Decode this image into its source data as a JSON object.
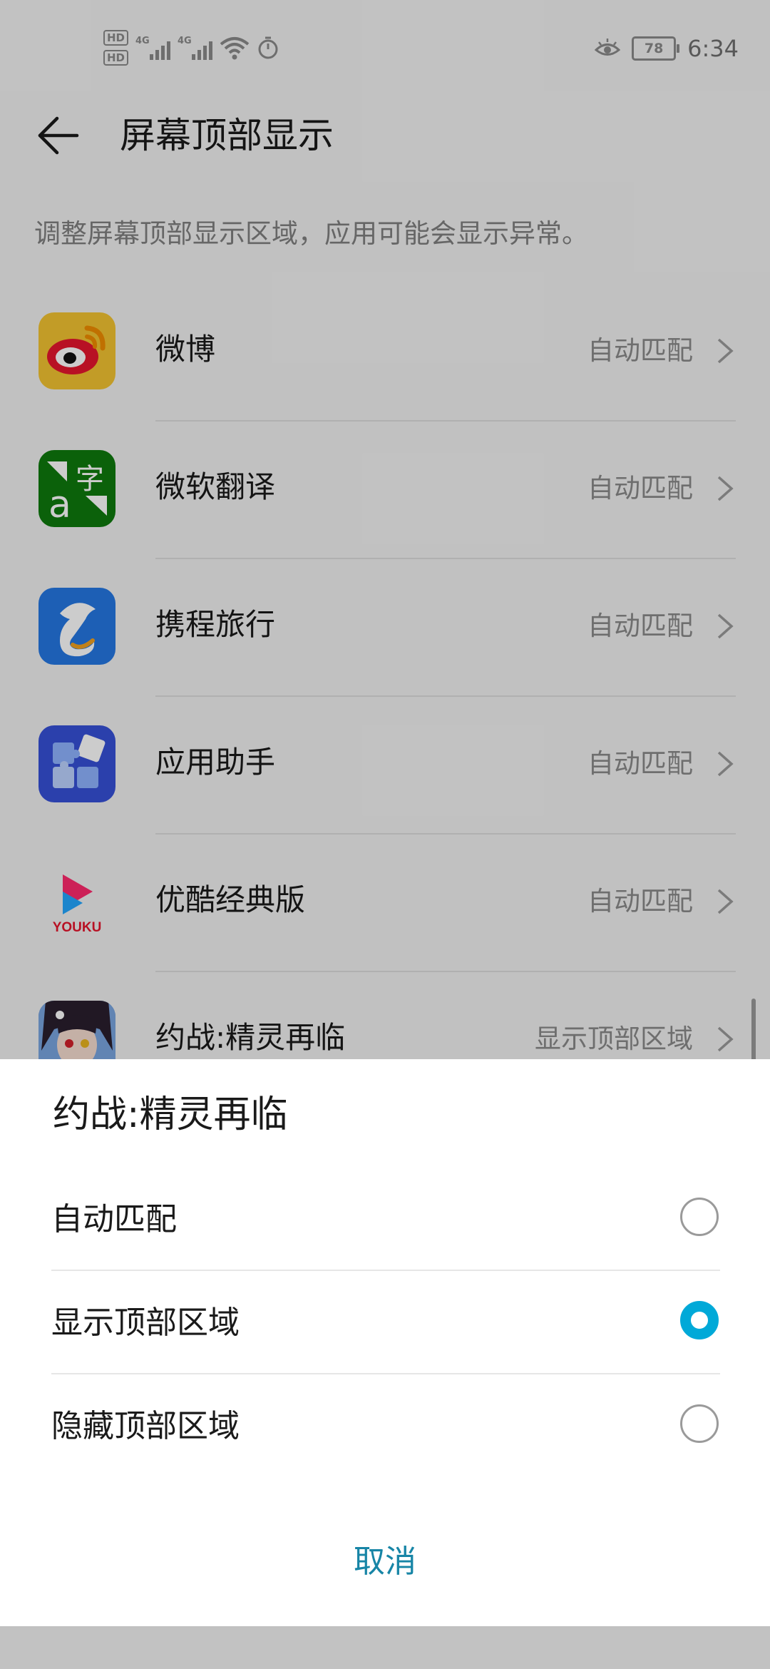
{
  "status_bar": {
    "hd1": "HD",
    "hd2": "HD",
    "net1": "4G",
    "net2": "4G",
    "battery": "78",
    "time": "6:34"
  },
  "header": {
    "title": "屏幕顶部显示"
  },
  "subtitle": "调整屏幕顶部显示区域，应用可能会显示异常。",
  "apps": [
    {
      "name": "微博",
      "mode": "自动匹配",
      "icon": "weibo-icon"
    },
    {
      "name": "微软翻译",
      "mode": "自动匹配",
      "icon": "microsoft-translator-icon"
    },
    {
      "name": "携程旅行",
      "mode": "自动匹配",
      "icon": "ctrip-dolphin-icon"
    },
    {
      "name": "应用助手",
      "mode": "自动匹配",
      "icon": "puzzle-icon"
    },
    {
      "name": "优酷经典版",
      "mode": "自动匹配",
      "icon": "youku-icon",
      "icon_text": "YOUKU"
    },
    {
      "name": "约战:精灵再临",
      "mode": "显示顶部区域",
      "icon": "anime-game-icon"
    }
  ],
  "dialog": {
    "title": "约战:精灵再临",
    "options": [
      {
        "label": "自动匹配",
        "selected": false
      },
      {
        "label": "显示顶部区域",
        "selected": true
      },
      {
        "label": "隐藏顶部区域",
        "selected": false
      }
    ],
    "cancel_label": "取消",
    "accent_color": "#00a9d8"
  }
}
